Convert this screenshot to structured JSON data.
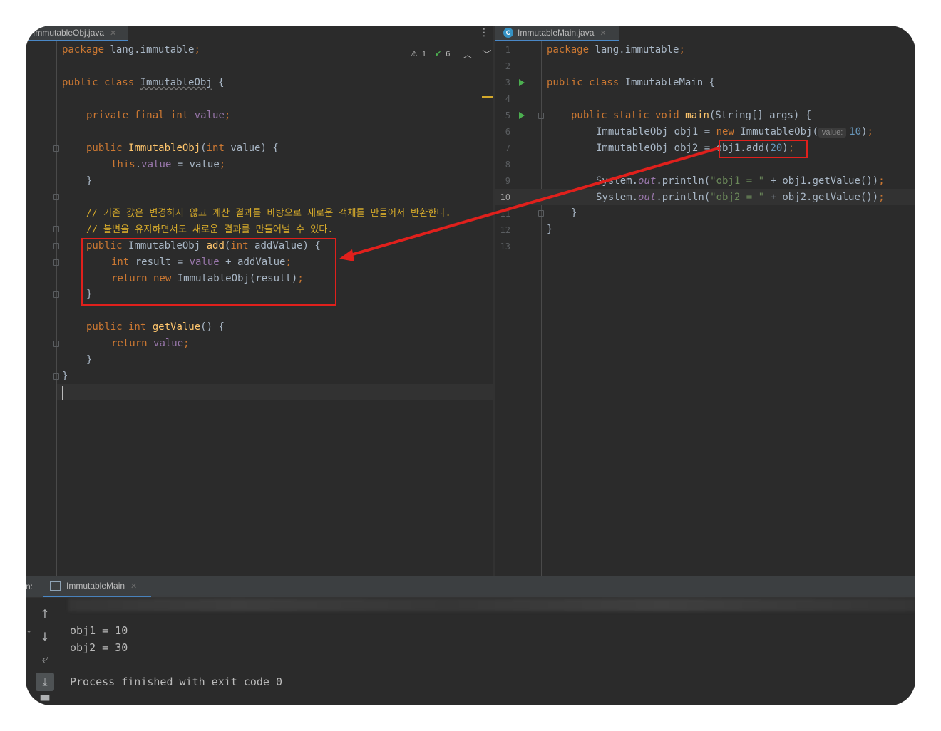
{
  "left_editor": {
    "tab_label": "ImmutableObj.java",
    "inspection": {
      "warnings": "1",
      "checks": "6"
    },
    "lines": {
      "l1_kw": "package",
      "l1_rest": " lang.immutable",
      "l1_semi": ";",
      "l3_kw": "public class",
      "l3_name": "ImmutableObj",
      "l3_rest": " {",
      "l5_kw": "private final int",
      "l5_fld": "value",
      "l5_semi": ";",
      "l7_kw": "public",
      "l7_fn": "ImmutableObj",
      "l7_p1": "(",
      "l7_kw2": "int",
      "l7_rest": " value) {",
      "l8_kw": "this",
      "l8_dot": ".",
      "l8_fld": "value",
      "l8_rest": " = value",
      "l8_semi": ";",
      "l9": "}",
      "l11": "// 기존 값은 변경하지 않고 계산 결과를 바탕으로 새로운 객체를 만들어서 반환한다.",
      "l12": "// 불변을 유지하면서도 새로운 결과를 만들어낼 수 있다.",
      "l13_kw": "public",
      "l13_type": " ImmutableObj ",
      "l13_fn": "add",
      "l13_p1": "(",
      "l13_kw2": "int",
      "l13_rest": " addValue) {",
      "l14_kw": "int",
      "l14_rest": " result = ",
      "l14_fld": "value",
      "l14_rest2": " + addValue",
      "l14_semi": ";",
      "l15_kw": "return new",
      "l15_rest": " ImmutableObj(result)",
      "l15_semi": ";",
      "l16": "}",
      "l18_kw": "public int",
      "l18_fn": "getValue",
      "l18_rest": "() {",
      "l19_kw": "return",
      "l19_fld": "value",
      "l19_semi": ";",
      "l20": "}",
      "l21": "}"
    }
  },
  "right_editor": {
    "tab_label": "ImmutableMain.java",
    "line_numbers": [
      "1",
      "2",
      "3",
      "4",
      "5",
      "6",
      "7",
      "8",
      "9",
      "10",
      "11",
      "12",
      "13"
    ],
    "lines": {
      "l1_kw": "package",
      "l1_rest": " lang.immutable",
      "l1_semi": ";",
      "l3_kw": "public class",
      "l3_rest": " ImmutableMain {",
      "l5_kw": "public static void",
      "l5_fn": "main",
      "l5_rest": "(String[] args) {",
      "l6_a": "ImmutableObj obj1 = ",
      "l6_kw": "new",
      "l6_b": " ImmutableObj(",
      "l6_hint": "value:",
      "l6_num": "10",
      "l6_c": ")",
      "l6_semi": ";",
      "l7_a": "ImmutableObj obj2 = ",
      "l7_b": "obj1.add(",
      "l7_num": "20",
      "l7_c": ")",
      "l7_semi": ";",
      "l9_a": "System.",
      "l9_out": "out",
      "l9_b": ".println(",
      "l9_str": "\"obj1 = \"",
      "l9_c": " + obj1.getValue())",
      "l9_semi": ";",
      "l10_a": "System.",
      "l10_out": "out",
      "l10_b": ".println(",
      "l10_str": "\"obj2 = \"",
      "l10_c": " + obj2.getValue())",
      "l10_semi": ";",
      "l11": "}",
      "l12": "}"
    }
  },
  "run_panel": {
    "prefix": "n:",
    "tab_label": "ImmutableMain",
    "output": [
      "obj1 = 10",
      "obj2 = 30",
      "",
      "Process finished with exit code 0"
    ]
  },
  "colors": {
    "background": "#2b2b2b",
    "keyword": "#cc7832",
    "field": "#9876aa",
    "method": "#ffc66d",
    "number": "#6897bb",
    "string": "#6a8759",
    "annotation": "#e0201c"
  }
}
